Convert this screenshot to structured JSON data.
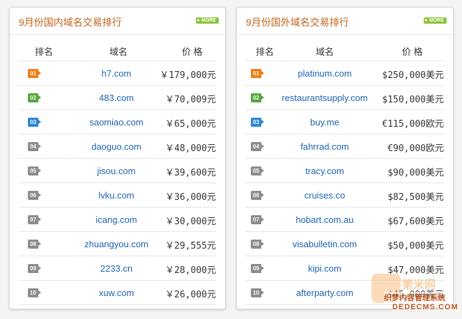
{
  "colors": {
    "title": "#c0621b",
    "link": "#1f62b0",
    "more_badge": "#8fc33c",
    "rank_1": "#f07d12",
    "rank_2": "#54a63c",
    "rank_3": "#2b86d4",
    "rank_other": "#8c8c8c"
  },
  "left_panel": {
    "title": "9月份国内域名交易排行",
    "more_label": "MORE",
    "headers": {
      "rank": "排名",
      "domain": "域名",
      "price": "价 格"
    },
    "rows": [
      {
        "rank": "01",
        "domain": "h7.com",
        "price": "￥179,000元"
      },
      {
        "rank": "02",
        "domain": "483.com",
        "price": "￥70,009元"
      },
      {
        "rank": "03",
        "domain": "saomiao.com",
        "price": "￥65,000元"
      },
      {
        "rank": "04",
        "domain": "daoguo.com",
        "price": "￥48,000元"
      },
      {
        "rank": "05",
        "domain": "jisou.com",
        "price": "￥39,600元"
      },
      {
        "rank": "06",
        "domain": "lvku.com",
        "price": "￥36,000元"
      },
      {
        "rank": "07",
        "domain": "icang.com",
        "price": "￥30,000元"
      },
      {
        "rank": "08",
        "domain": "zhuangyou.com",
        "price": "￥29,555元"
      },
      {
        "rank": "09",
        "domain": "2233.cn",
        "price": "￥28,000元"
      },
      {
        "rank": "10",
        "domain": "xuw.com",
        "price": "￥26,000元"
      }
    ]
  },
  "right_panel": {
    "title": "9月份国外域名交易排行",
    "more_label": "MORE",
    "headers": {
      "rank": "排名",
      "domain": "域名",
      "price": "价 格"
    },
    "rows": [
      {
        "rank": "01",
        "domain": "platinum.com",
        "price": "$250,000美元"
      },
      {
        "rank": "02",
        "domain": "restaurantsupply.com",
        "price": "$150,000美元"
      },
      {
        "rank": "03",
        "domain": "buy.me",
        "price": "€115,000欧元"
      },
      {
        "rank": "04",
        "domain": "fahrrad.com",
        "price": "€90,000欧元"
      },
      {
        "rank": "05",
        "domain": "tracy.com",
        "price": "$90,000美元"
      },
      {
        "rank": "06",
        "domain": "cruises.co",
        "price": "$82,500美元"
      },
      {
        "rank": "07",
        "domain": "hobart.com.au",
        "price": "$67,600美元"
      },
      {
        "rank": "08",
        "domain": "visabulletin.com",
        "price": "$50,000美元"
      },
      {
        "rank": "09",
        "domain": "kipi.com",
        "price": "$47,000美元"
      },
      {
        "rank": "10",
        "domain": "afterparty.com",
        "price": "$45,000美元"
      }
    ]
  },
  "watermark": {
    "brand_cn": "第米网",
    "line1": "织梦内容管理系统",
    "line2": "DEDECMS.COM"
  }
}
